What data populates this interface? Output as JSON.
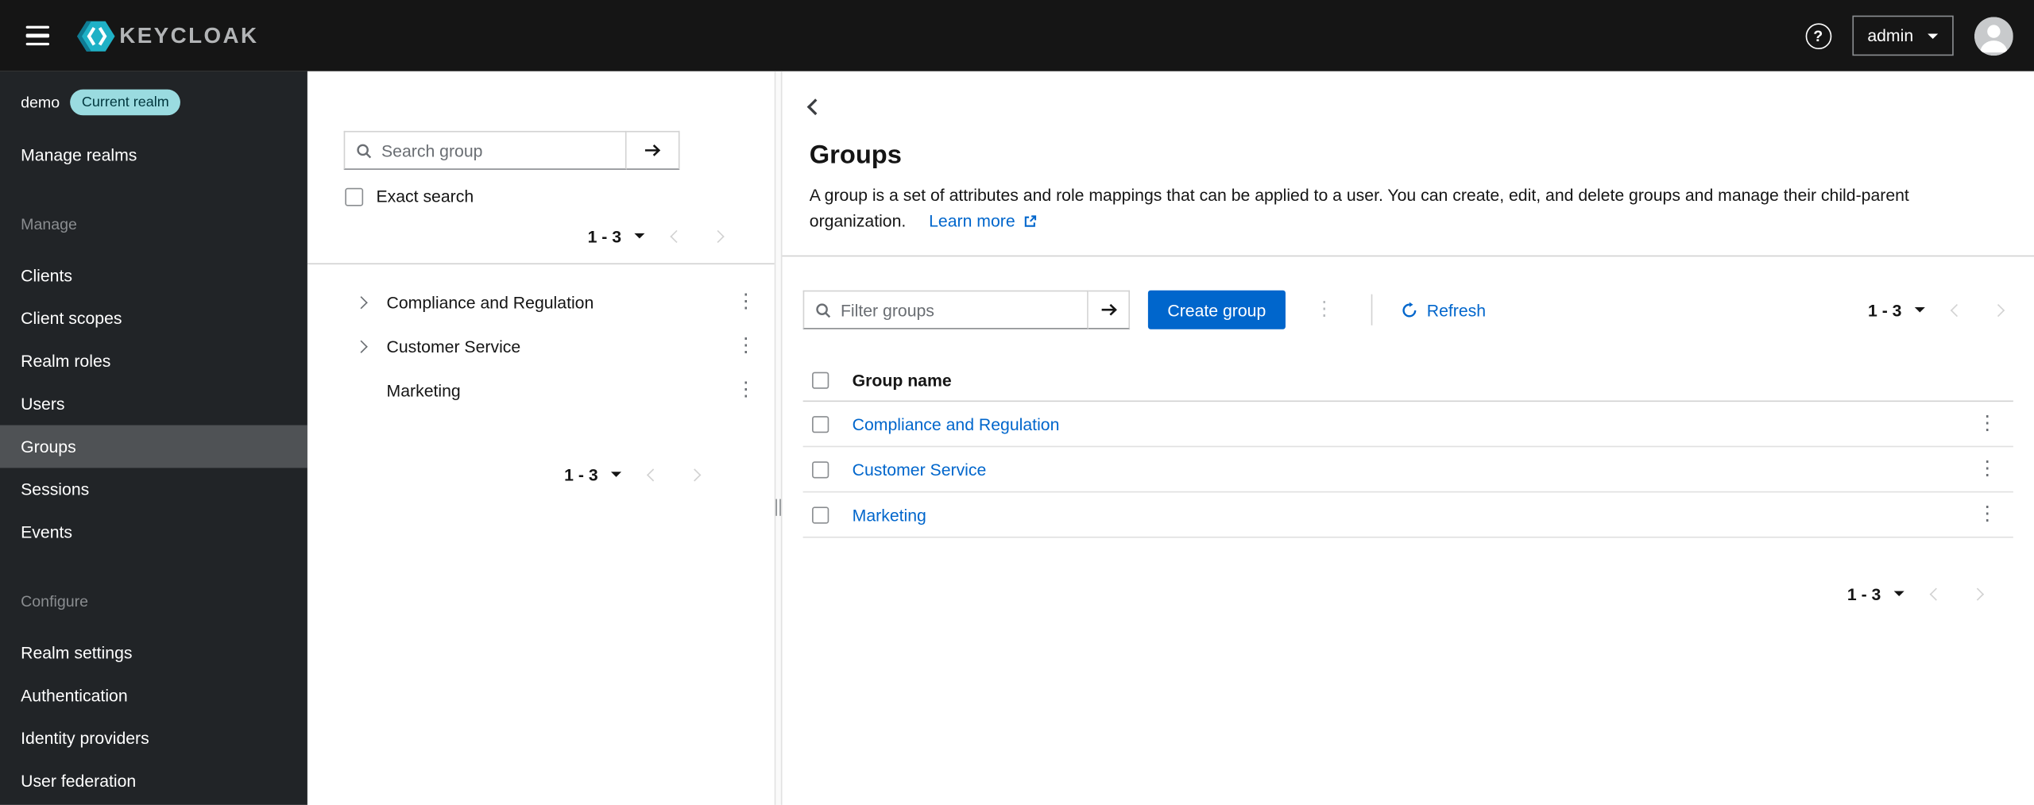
{
  "masthead": {
    "brand": "KEYCLOAK",
    "username": "admin"
  },
  "sidebar": {
    "realm_name": "demo",
    "realm_badge": "Current realm",
    "manage_realms_label": "Manage realms",
    "sections": [
      {
        "title": "Manage",
        "items": [
          {
            "label": "Clients"
          },
          {
            "label": "Client scopes"
          },
          {
            "label": "Realm roles"
          },
          {
            "label": "Users"
          },
          {
            "label": "Groups"
          },
          {
            "label": "Sessions"
          },
          {
            "label": "Events"
          }
        ]
      },
      {
        "title": "Configure",
        "items": [
          {
            "label": "Realm settings"
          },
          {
            "label": "Authentication"
          },
          {
            "label": "Identity providers"
          },
          {
            "label": "User federation"
          }
        ]
      }
    ]
  },
  "tree_panel": {
    "search_placeholder": "Search group",
    "exact_search_label": "Exact search",
    "pagination_range": "1 - 3",
    "items": [
      {
        "name": "Compliance and Regulation",
        "expandable": true
      },
      {
        "name": "Customer Service",
        "expandable": true
      },
      {
        "name": "Marketing",
        "expandable": false
      }
    ],
    "bottom_pagination_range": "1 - 3"
  },
  "main": {
    "page_title": "Groups",
    "description": "A group is a set of attributes and role mappings that can be applied to a user. You can create, edit, and delete groups and manage their child-parent organization.",
    "learn_more_label": "Learn more",
    "toolbar": {
      "filter_placeholder": "Filter groups",
      "create_button_label": "Create group",
      "refresh_label": "Refresh",
      "pagination_range": "1 - 3"
    },
    "table": {
      "header_group_name": "Group name",
      "rows": [
        {
          "name": "Compliance and Regulation"
        },
        {
          "name": "Customer Service"
        },
        {
          "name": "Marketing"
        }
      ]
    },
    "bottom_pagination_range": "1 - 3"
  },
  "icons": {
    "kebab": "⋮",
    "help": "?"
  },
  "colors": {
    "primary_blue": "#0066cc",
    "link_blue": "#0066cc",
    "masthead_bg": "#151515",
    "sidebar_bg": "#212427",
    "nav_selected_bg": "#4f5255",
    "realm_badge_bg": "#9adbe0",
    "realm_badge_text": "#00363d",
    "keycloak_cyan": "#1fb1c6",
    "disabled_gray": "#d2d2d2"
  }
}
